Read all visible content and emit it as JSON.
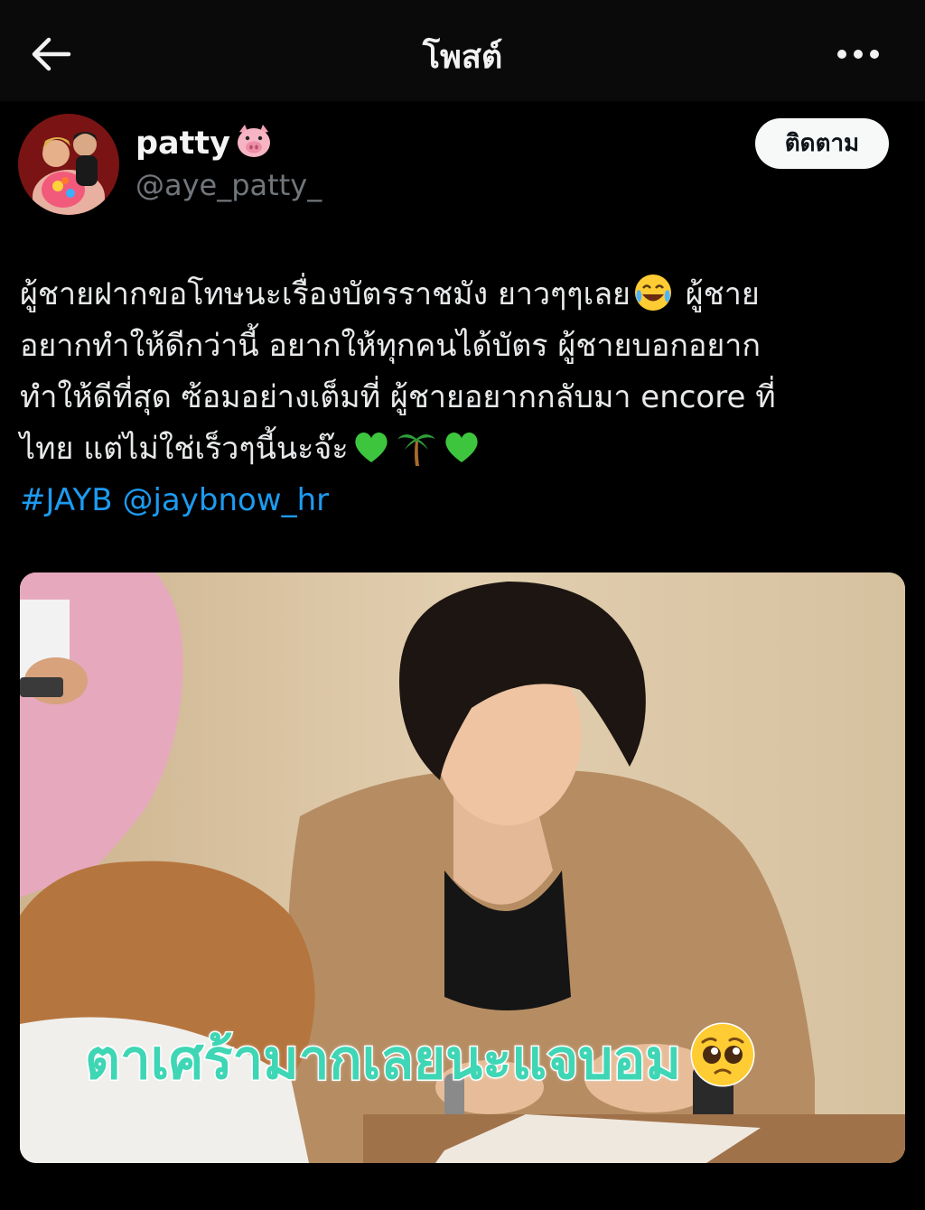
{
  "header": {
    "title": "โพสต์",
    "back_icon": "arrow-left-icon",
    "more_icon": "more-horizontal-icon"
  },
  "author": {
    "display_name": "patty",
    "name_emoji": "pig-face-icon",
    "handle": "@aye_patty_",
    "follow_label": "ติดตาม"
  },
  "tweet": {
    "line1": "ผู้ชายฝากขอโทษนะเรื่องบัตรราชมัง ยาวๆๆเลย",
    "line1_after": " ผู้ชาย",
    "line2": "อยากทำให้ดีกว่านี้ อยากให้ทุกคนได้บัตร ผู้ชายบอกอยาก",
    "line3": "ทำให้ดีที่สุด  ซ้อมอย่างเต็มที่ ผู้ชายอยากกลับมา encore ที่",
    "line4": "ไทย แต่ไม่ใช่เร็วๆนี้นะจ๊ะ",
    "hashtag": "#JAYB",
    "mention": "@jaybnow_hr",
    "emojis": [
      "laughing-tears-icon",
      "green-heart-icon",
      "palm-tree-icon",
      "green-heart-icon"
    ]
  },
  "media": {
    "caption": "ตาเศร้ามากเลยนะแจบอม",
    "caption_emoji": "pleading-face-icon",
    "colors": {
      "caption_fill": "#3fd6b5",
      "caption_stroke": "#ffffff"
    }
  },
  "colors": {
    "link": "#1d9bf0",
    "background": "#000000",
    "handle": "#71767b"
  }
}
